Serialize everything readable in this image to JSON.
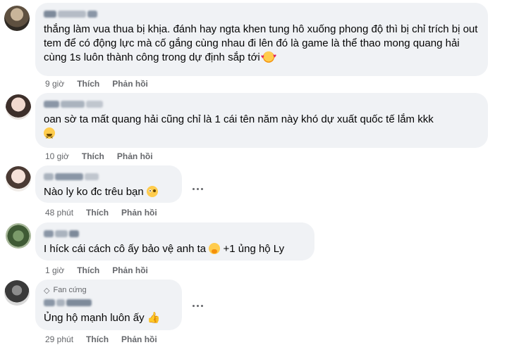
{
  "comments": [
    {
      "text": "thắng làm vua thua bị khịa. đánh hay ngta khen tung hô xuống phong độ thì bị chỉ trích bị out tem để có động lực mà cố gắng cùng nhau đi lên đó là game là thể thao mong quang hải cùng 1s luôn thành công trong dự định sắp tới",
      "time": "9 giờ",
      "like": "Thích",
      "reply": "Phản hồi"
    },
    {
      "text": "oan sờ ta mất quang hải cũng chỉ là 1 cái tên năm này khó dự xuất quốc tế lắm kkk",
      "time": "10 giờ",
      "like": "Thích",
      "reply": "Phản hồi"
    },
    {
      "text": "Nào ly ko đc trêu bạn",
      "time": "48 phút",
      "like": "Thích",
      "reply": "Phản hồi"
    },
    {
      "text_a": "I híck cái cách cô ấy bảo vệ anh ta",
      "text_b": "+1 ủng hộ Ly",
      "time": "1 giờ",
      "like": "Thích",
      "reply": "Phản hồi"
    },
    {
      "badge": "Fan cứng",
      "text": "Ủng hộ mạnh luôn ấy",
      "time": "29 phút",
      "like": "Thích",
      "reply": "Phản hồi"
    }
  ]
}
